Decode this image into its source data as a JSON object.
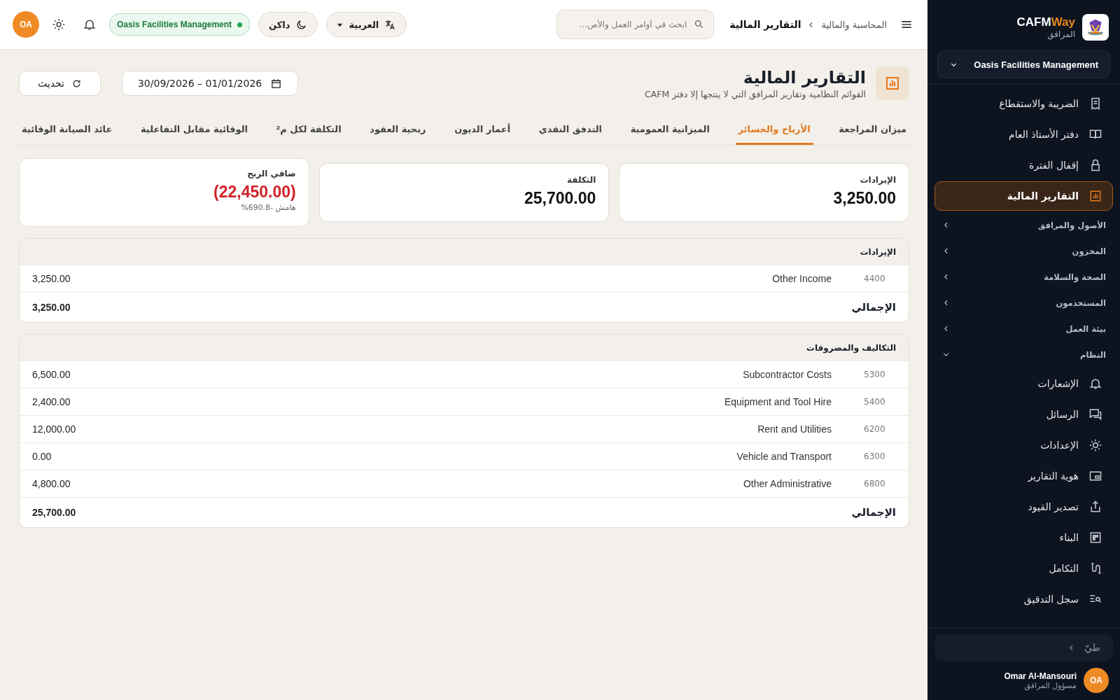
{
  "sidebar": {
    "brand": {
      "name": "CAFM",
      "accent": "Way",
      "subtitle": "المرافق"
    },
    "org_selector": "Oasis Facilities Management",
    "links": [
      {
        "label": "الضريبة والاستقطاع",
        "selected": false
      },
      {
        "label": "دفتر الأستاذ العام",
        "selected": false
      },
      {
        "label": "إقفال الفترة",
        "selected": false
      },
      {
        "label": "التقارير المالية",
        "selected": true
      }
    ],
    "groups": [
      {
        "label": "الأصول والمرافق",
        "expanded": false
      },
      {
        "label": "المخزون",
        "expanded": false
      },
      {
        "label": "الصحة والسلامة",
        "expanded": false
      },
      {
        "label": "المستخدمون",
        "expanded": false
      },
      {
        "label": "بيئة العمل",
        "expanded": false
      },
      {
        "label": "النظام",
        "expanded": true,
        "children": [
          {
            "label": "الإشعارات",
            "selected": false
          },
          {
            "label": "الرسائل",
            "selected": false
          },
          {
            "label": "الإعدادات",
            "selected": false
          },
          {
            "label": "هوية التقارير",
            "selected": false
          },
          {
            "label": "تصدير القيود",
            "selected": false
          },
          {
            "label": "البناء",
            "selected": false
          },
          {
            "label": "التكامل",
            "selected": false
          },
          {
            "label": "سجل التدقيق",
            "selected": false
          }
        ]
      }
    ],
    "collapse": "طيّ",
    "user": {
      "name": "Omar Al-Mansouri",
      "role": "مسؤول المرافق",
      "initials": "OA"
    }
  },
  "topbar": {
    "breadcrumb": [
      "المحاسبة والمالية",
      "التقارير المالية"
    ],
    "search": {
      "placeholder": "ابحث في أوامر العمل والأص..."
    },
    "language": "العربية",
    "theme": "داكن",
    "organization": "Oasis Facilities Management",
    "avatar": "OA"
  },
  "header": {
    "title": "التقارير المالية",
    "subtitle": "القوائم النظامية وتقارير المرافق التي لا ينتجها إلا دفتر CAFM",
    "date_range": "30/09/2026 – 01/01/2026",
    "refresh": "تحديث"
  },
  "tabs": [
    {
      "label": "ميزان المراجعة",
      "selected": false
    },
    {
      "label": "الأرباح والخسائر",
      "selected": true
    },
    {
      "label": "الميزانية العمومية",
      "selected": false
    },
    {
      "label": "التدفق النقدي",
      "selected": false
    },
    {
      "label": "أعمار الديون",
      "selected": false
    },
    {
      "label": "ربحية العقود",
      "selected": false
    },
    {
      "label": "التكلفة لكل م²",
      "selected": false
    },
    {
      "label": "الوقائية مقابل التفاعلية",
      "selected": false
    },
    {
      "label": "عائد الصيانة الوقائية",
      "selected": false
    }
  ],
  "kpis": [
    {
      "label": "الإيرادات",
      "value": "3,250.00",
      "negative": false
    },
    {
      "label": "التكلفة",
      "value": "25,700.00",
      "negative": false
    },
    {
      "label": "صافي الربح",
      "value": "(22,450.00)",
      "negative": true,
      "note": "هامش -690.8%"
    }
  ],
  "sections": [
    {
      "title": "الإيرادات",
      "rows": [
        {
          "code": "4400",
          "name": "Other Income",
          "amount": "3,250.00"
        }
      ],
      "total": {
        "label": "الإجمالي",
        "amount": "3,250.00"
      }
    },
    {
      "title": "التكاليف والمصروفات",
      "rows": [
        {
          "code": "5300",
          "name": "Subcontractor Costs",
          "amount": "6,500.00"
        },
        {
          "code": "5400",
          "name": "Equipment and Tool Hire",
          "amount": "2,400.00"
        },
        {
          "code": "6200",
          "name": "Rent and Utilities",
          "amount": "12,000.00"
        },
        {
          "code": "6300",
          "name": "Vehicle and Transport",
          "amount": "0.00"
        },
        {
          "code": "6800",
          "name": "Other Administrative",
          "amount": "4,800.00"
        }
      ],
      "total": {
        "label": "الإجمالي",
        "amount": "25,700.00"
      }
    }
  ]
}
